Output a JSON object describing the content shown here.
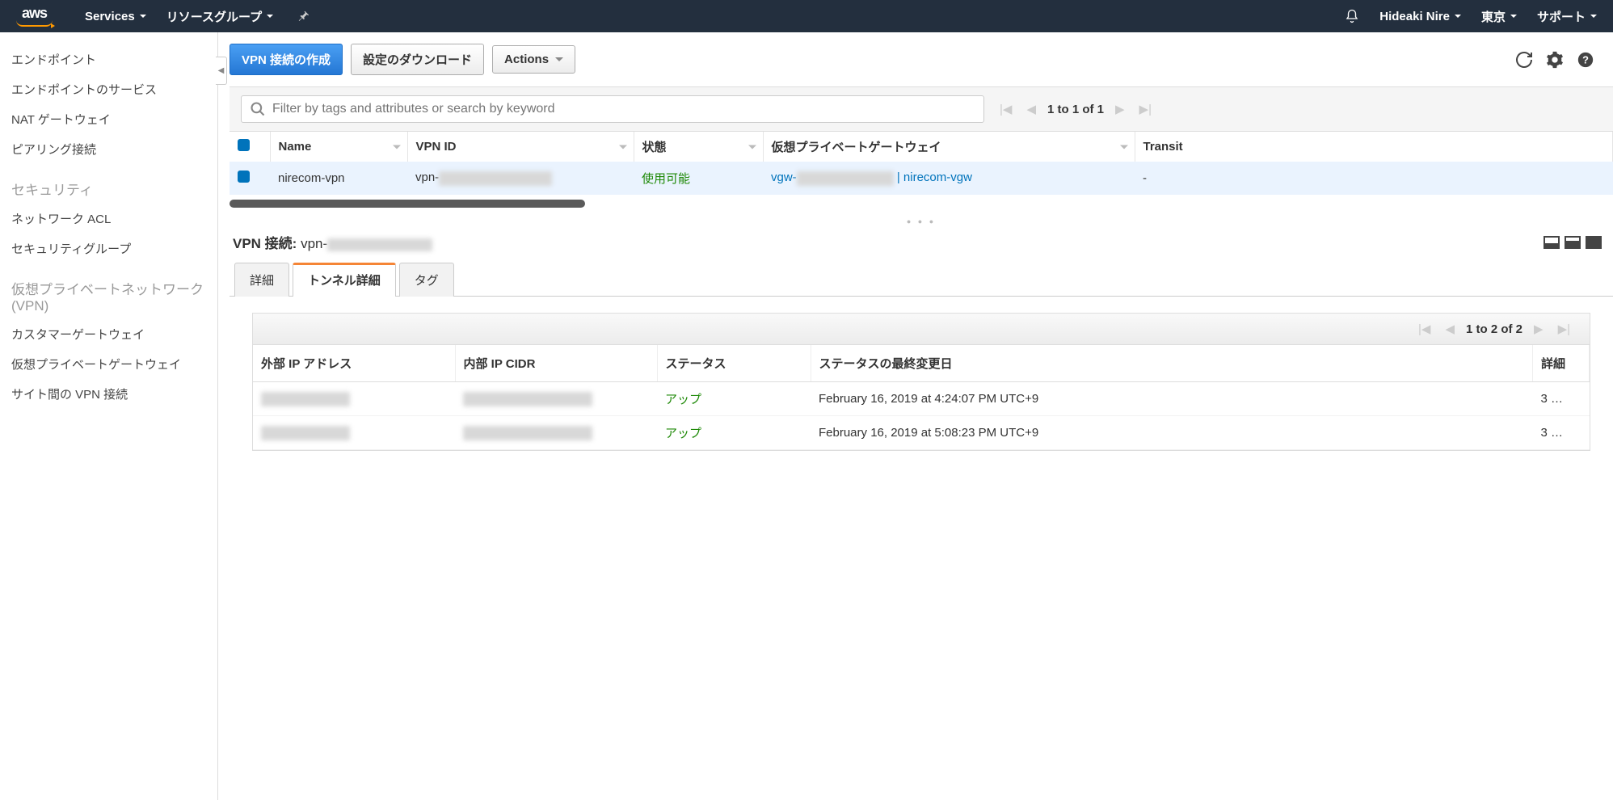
{
  "topnav": {
    "services": "Services",
    "resource_groups": "リソースグループ",
    "user": "Hideaki Nire",
    "region": "東京",
    "support": "サポート"
  },
  "sidebar": {
    "items": [
      "エンドポイント",
      "エンドポイントのサービス",
      "NAT ゲートウェイ",
      "ピアリング接続"
    ],
    "heading_security": "セキュリティ",
    "security_items": [
      "ネットワーク ACL",
      "セキュリティグループ"
    ],
    "heading_vpn": "仮想プライベートネットワーク (VPN)",
    "vpn_items": [
      "カスタマーゲートウェイ",
      "仮想プライベートゲートウェイ",
      "サイト間の VPN 接続"
    ]
  },
  "actions": {
    "create_vpn": "VPN 接続の作成",
    "download_config": "設定のダウンロード",
    "actions": "Actions"
  },
  "search": {
    "placeholder": "Filter by tags and attributes or search by keyword"
  },
  "pager_main": "1 to 1 of 1",
  "table": {
    "headers": {
      "name": "Name",
      "vpn_id": "VPN ID",
      "state": "状態",
      "vgw": "仮想プライベートゲートウェイ",
      "transit": "Transit"
    },
    "row": {
      "name": "nirecom-vpn",
      "vpn_id_prefix": "vpn-",
      "state": "使用可能",
      "vgw_prefix": "vgw-",
      "vgw_name": " | nirecom-vgw",
      "transit": "-"
    }
  },
  "detail": {
    "title_label": "VPN 接続:",
    "title_value": "vpn-"
  },
  "tabs": {
    "details": "詳細",
    "tunnel": "トンネル詳細",
    "tags": "タグ"
  },
  "tunnel": {
    "pager": "1 to 2 of 2",
    "headers": {
      "outer_ip": "外部 IP アドレス",
      "inner_cidr": "内部 IP CIDR",
      "status": "ステータス",
      "status_change": "ステータスの最終変更日",
      "details": "詳細"
    },
    "rows": [
      {
        "status": "アップ",
        "changed": "February 16, 2019 at 4:24:07 PM UTC+9",
        "details": "3 …"
      },
      {
        "status": "アップ",
        "changed": "February 16, 2019 at 5:08:23 PM UTC+9",
        "details": "3 …"
      }
    ]
  }
}
